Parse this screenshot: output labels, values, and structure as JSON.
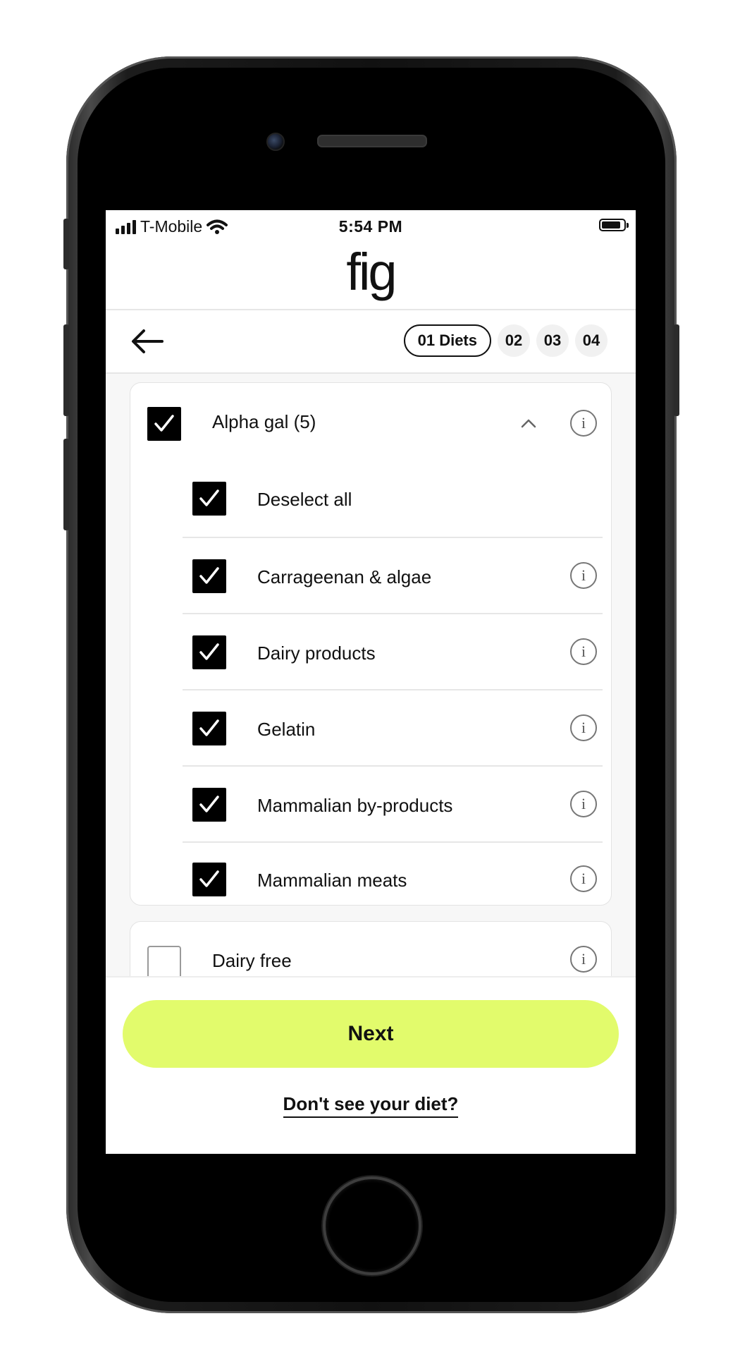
{
  "status_bar": {
    "carrier": "T-Mobile",
    "time": "5:54 PM"
  },
  "app": {
    "logo": "fig"
  },
  "nav": {
    "steps": [
      "01 Diets",
      "02",
      "03",
      "04"
    ],
    "active_step": 0
  },
  "groups": [
    {
      "label": "Alpha gal (5)",
      "checked": true,
      "expanded": true,
      "items": [
        {
          "label": "Deselect all",
          "checked": true,
          "info": false
        },
        {
          "label": "Carrageenan & algae",
          "checked": true,
          "info": true
        },
        {
          "label": "Dairy products",
          "checked": true,
          "info": true
        },
        {
          "label": "Gelatin",
          "checked": true,
          "info": true
        },
        {
          "label": "Mammalian by-products",
          "checked": true,
          "info": true
        },
        {
          "label": "Mammalian meats",
          "checked": true,
          "info": true
        }
      ]
    },
    {
      "label": "Dairy free",
      "checked": false,
      "expanded": false,
      "items": []
    }
  ],
  "footer": {
    "next_label": "Next",
    "diet_link": "Don't see your diet?"
  },
  "icons": {
    "info": "i",
    "accent_color": "#e2fb6c"
  }
}
